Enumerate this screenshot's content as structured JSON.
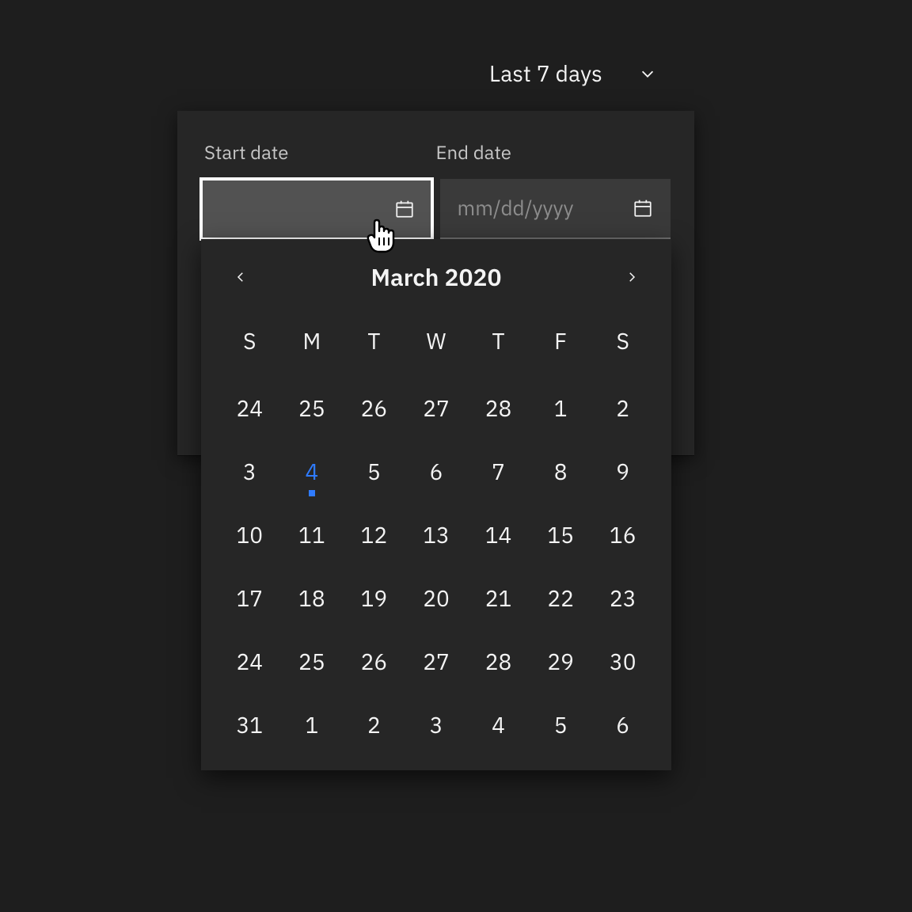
{
  "preset": {
    "selected_label": "Last 7 days"
  },
  "range": {
    "start_label": "Start date",
    "end_label": "End date",
    "start_value": "",
    "end_placeholder": "mm/dd/yyyy"
  },
  "calendar": {
    "month_title": "March 2020",
    "dow": [
      "S",
      "M",
      "T",
      "W",
      "T",
      "F",
      "S"
    ],
    "today_index": 9,
    "cells": [
      {
        "n": 24,
        "other": true
      },
      {
        "n": 25,
        "other": true
      },
      {
        "n": 26,
        "other": true
      },
      {
        "n": 27,
        "other": true
      },
      {
        "n": 28,
        "other": true
      },
      {
        "n": 1
      },
      {
        "n": 2
      },
      {
        "n": 3
      },
      {
        "n": 4,
        "today": true
      },
      {
        "n": 5
      },
      {
        "n": 6
      },
      {
        "n": 7
      },
      {
        "n": 8
      },
      {
        "n": 9
      },
      {
        "n": 10
      },
      {
        "n": 11
      },
      {
        "n": 12
      },
      {
        "n": 13
      },
      {
        "n": 14
      },
      {
        "n": 15
      },
      {
        "n": 16
      },
      {
        "n": 17
      },
      {
        "n": 18
      },
      {
        "n": 19
      },
      {
        "n": 20
      },
      {
        "n": 21
      },
      {
        "n": 22
      },
      {
        "n": 23
      },
      {
        "n": 24
      },
      {
        "n": 25
      },
      {
        "n": 26
      },
      {
        "n": 27
      },
      {
        "n": 28
      },
      {
        "n": 29
      },
      {
        "n": 30
      },
      {
        "n": 31
      },
      {
        "n": 1,
        "other": true
      },
      {
        "n": 2,
        "other": true
      },
      {
        "n": 3,
        "other": true
      },
      {
        "n": 4,
        "other": true
      },
      {
        "n": 5,
        "other": true
      },
      {
        "n": 6,
        "other": true
      }
    ]
  },
  "colors": {
    "accent": "#2f7bff",
    "bg": "#1e1e1e",
    "panel": "#262626"
  }
}
